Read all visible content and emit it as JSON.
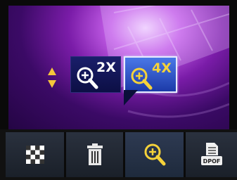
{
  "zoom_popup": {
    "options": [
      {
        "label": "2X",
        "icon": "magnifier-plus-icon",
        "selected": false
      },
      {
        "label": "4X",
        "icon": "magnifier-plus-icon",
        "selected": true
      }
    ],
    "scroll_indicator_icon": "up-down-arrows-icon"
  },
  "toolbar": {
    "items": [
      {
        "icon": "checkerboard-icon"
      },
      {
        "icon": "trash-icon"
      },
      {
        "icon": "zoom-icon",
        "active": true
      },
      {
        "icon": "dpof-print-icon",
        "text": "DPOF"
      }
    ]
  },
  "colors": {
    "accent_yellow": "#f5c63a",
    "selected_blue": "#3a66d8",
    "unselected_navy": "#0c0f45",
    "toolbar_bg": "#1f2531",
    "background_purple": "#7a1ca8"
  }
}
